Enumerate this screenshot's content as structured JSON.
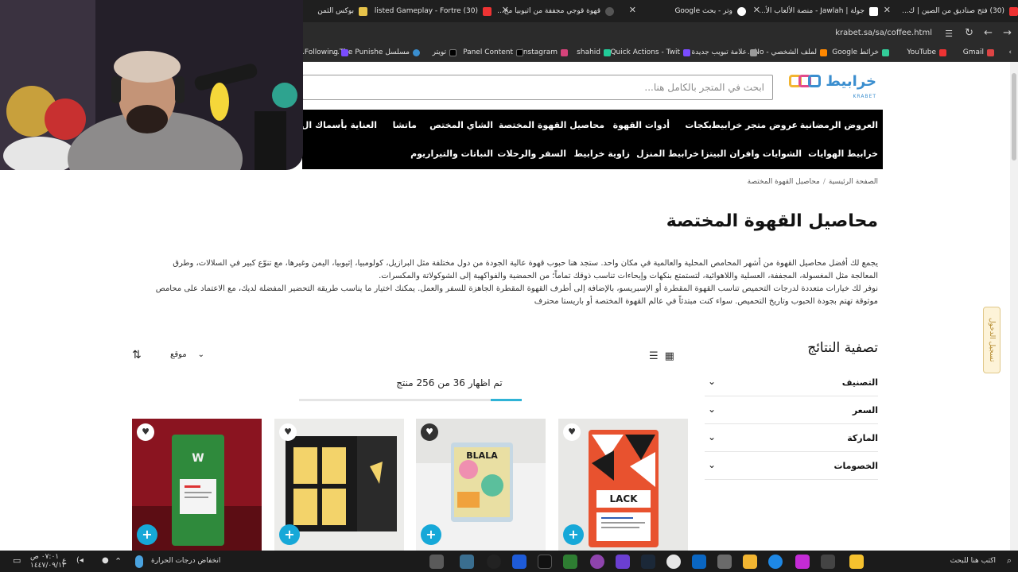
{
  "browser": {
    "tabs": [
      {
        "label": "(30) فتح صناديق من الصين | ك...",
        "color": "#e33"
      },
      {
        "label": "جولة | Jawlah - منصة الألعاب الأ...",
        "color": "#fff"
      },
      {
        "label": "وتر - بحث Google",
        "color": "#fff"
      },
      {
        "label": "قهوة قوجي مجففة من اثيوبيا مح...",
        "color": "#555"
      },
      {
        "label": "(30) Enlisted Gameplay - Fortre...",
        "color": "#e33"
      },
      {
        "label": "بوكس الثمن",
        "color": "#e7c34a"
      }
    ],
    "url": "krabet.sa/sa/coffee.html",
    "bookmarks": [
      "Gmail",
      "YouTube",
      "خرائط Google",
      "لملف الشخصي - No...",
      "علامة تبويب جديدة",
      "Quick Actions - Twit...",
      "shahid",
      "Instagram",
      "Panel Content",
      "تويتر",
      "مسلسل The Punishe...",
      "Following..."
    ]
  },
  "site": {
    "logo_name": "خرابيط",
    "logo_sub": "KRABET",
    "search_placeholder": "ابحث في المتجر بالكامل هنا...",
    "nav_row1": [
      "العروض الرمضانية",
      "عروض متجر خرابيط",
      "بكجات",
      "أدوات القهوة",
      "محاصيل القهوة المختصة",
      "الشاي المختص",
      "ماتشا",
      "العناية بأسماك ال"
    ],
    "nav_row2": [
      "خرابيط الهوايات",
      "الشوايات وافران البيتزا",
      "خرابيط المنزل",
      "زاوية خرابيط",
      "السفر والرحلات",
      "النباتات والتيراريوم"
    ]
  },
  "breadcrumb": {
    "home": "الصفحة الرئيسية",
    "current": "محاصيل القهوة المختصة"
  },
  "page_title": "محاصيل القهوة المختصة",
  "description": [
    "يجمع لك أفضل محاصيل القهوة من أشهر المحامص المحلية والعالمية في مكان واحد. ستجد هنا حبوب قهوة عالية الجودة من دول مختلفة مثل البرازيل، كولومبيا، إثيوبيا، اليمن وغيرها، مع تنوّع كبير في السلالات، وطرق المعالجة مثل المغسولة، المجففة، العسلية واللاهوائية، لتستمتع بنكهات وإيحاءات تناسب ذوقك تماماً؛ من الحمضية والفواكهية إلى الشوكولاتة والمكسرات.",
    "نوفر لك خيارات متعددة لدرجات التحميص تناسب القهوة المقطرة أو الإسبريسو، بالإضافة إلى أطرف القهوة المقطرة الجاهزة للسفر والعمل. يمكنك اختيار ما يناسب طريقة التحضير المفضلة لديك، مع الاعتماد على محامص موثوقة تهتم بجودة الحبوب وتاريخ التحميص. سواء كنت مبتدئاً في عالم القهوة المختصة أو باريستا محترف"
  ],
  "filter": {
    "title": "تصفية النتائج",
    "facets": [
      "التصنيف",
      "السعر",
      "الماركة",
      "الخصومات"
    ]
  },
  "toolbar": {
    "sort_label": "موقع",
    "count_text": "تم اظهار 36 من 256 منتج",
    "progress": 0.14
  },
  "products": [
    {
      "bg": "#e8e8e6",
      "accent": "#e8522f"
    },
    {
      "bg": "#ececea",
      "accent": "#f3d36a"
    },
    {
      "bg": "#f2f2f2",
      "accent": "#1a1a1a"
    },
    {
      "bg": "#8a1420",
      "accent": "#2f8a3c"
    }
  ],
  "login_tab": "تسجيل الدخول",
  "taskbar": {
    "search": "اكتب هنا للبحث",
    "weather": "انخفاض درجات الحرارة",
    "time": "٠٧:٠١ ص",
    "date": "١٤٤٧/٠٩/١٣",
    "lang": "ع"
  },
  "colors": {
    "accent": "#16a8d8",
    "nav_bg": "#000000",
    "brand": "#3a8ecf"
  }
}
